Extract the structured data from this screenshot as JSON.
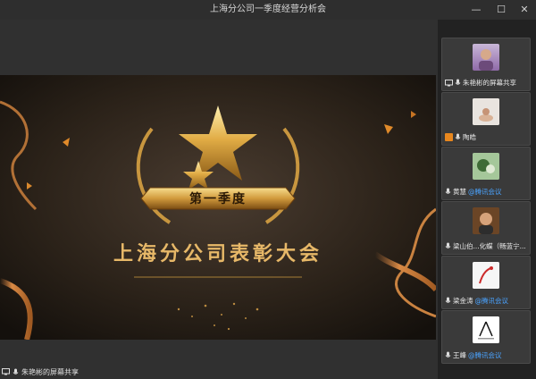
{
  "window": {
    "title": "上海分公司一季度经营分析会",
    "min_glyph": "—",
    "max_glyph": "☐",
    "close_glyph": "✕"
  },
  "slide": {
    "badge_text": "第一季度",
    "headline": "上海分公司表彰大会"
  },
  "footer": {
    "share_label": "朱艳彬的屏幕共享"
  },
  "participants": [
    {
      "name": "朱艳彬的屏幕共享",
      "tag": "",
      "icon": "screen-share-icon"
    },
    {
      "name": "陶皓",
      "tag": "",
      "icon": "orange-user-icon"
    },
    {
      "name": "黄慧",
      "tag": "@腾讯会议",
      "icon": "mic-icon"
    },
    {
      "name": "梁山伯...化蝶（畅蓝宁...",
      "tag": "",
      "icon": "mic-icon"
    },
    {
      "name": "梁金涛",
      "tag": "@腾讯会议",
      "icon": "mic-icon"
    },
    {
      "name": "王峰",
      "tag": "@腾讯会议",
      "icon": "mic-icon"
    }
  ],
  "colors": {
    "accent_tag": "#4aa3ff",
    "gold": "#d9a441",
    "muted_orange": "#e8871e"
  }
}
